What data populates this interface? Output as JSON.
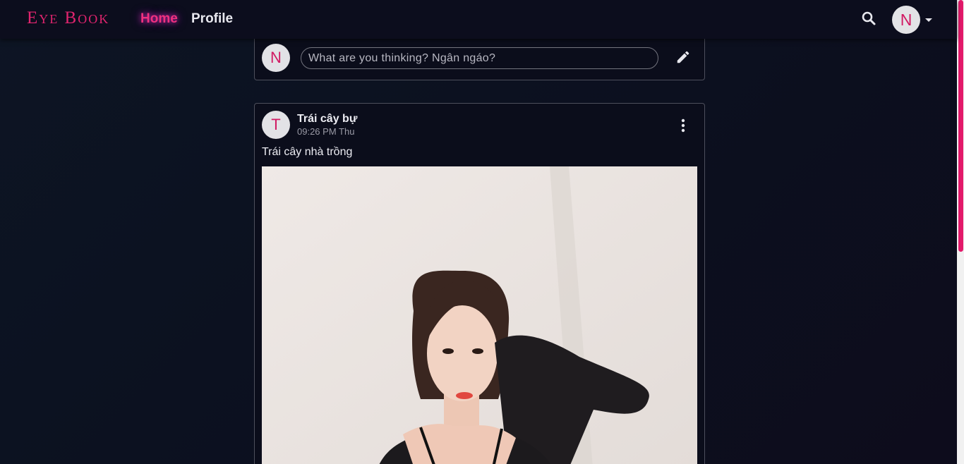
{
  "navbar": {
    "logo": "Eye Book",
    "links": [
      {
        "label": "Home",
        "active": true
      },
      {
        "label": "Profile",
        "active": false
      }
    ],
    "user_initial": "N"
  },
  "compose": {
    "user_initial": "N",
    "placeholder": "What are you thinking? Ngân ngáo?"
  },
  "posts": [
    {
      "author_initial": "T",
      "author": "Trái cây bự",
      "time": "09:26 PM Thu",
      "text": "Trái cây nhà trồng"
    }
  ],
  "colors": {
    "accent": "#e0246e",
    "navbar_bg": "#0c0d1d",
    "page_bg": "#0c1120",
    "card_border": "#4d4f5c"
  },
  "icons": {
    "search": "search-icon",
    "pencil": "pencil-icon",
    "more": "more-vertical-icon",
    "caret": "caret-down-icon"
  }
}
